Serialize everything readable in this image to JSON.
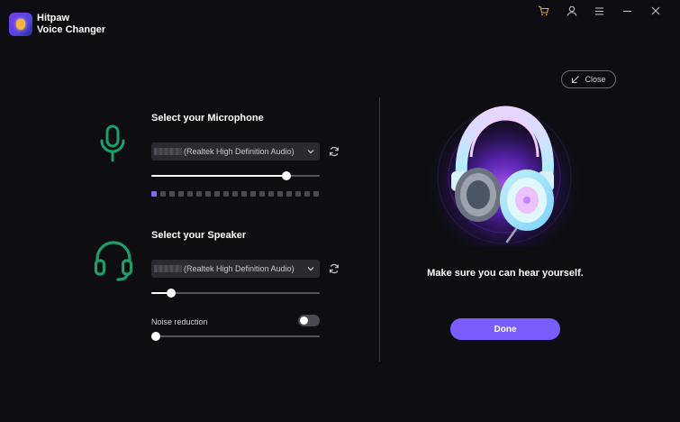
{
  "app": {
    "name_line1": "Hitpaw",
    "name_line2": "Voice Changer"
  },
  "window_controls": [
    "cart-icon",
    "user-icon",
    "menu-icon",
    "minimize-icon",
    "close-window-icon"
  ],
  "close_button": {
    "label": "Close",
    "icon": "arrow-down-left-icon"
  },
  "microphone": {
    "title": "Select your Microphone",
    "device": "(Realtek High Definition Audio)",
    "volume": 0.8,
    "level_segments_total": 19,
    "level_segments_active": 1
  },
  "speaker": {
    "title": "Select your Speaker",
    "device": "(Realtek High Definition Audio)",
    "volume": 0.12
  },
  "noise_reduction": {
    "label": "Noise reduction",
    "enabled": false,
    "level": 0.0
  },
  "right_panel": {
    "message": "Make sure you can hear yourself.",
    "done_label": "Done"
  },
  "colors": {
    "background": "#0e0e12",
    "accent": "#7a5cff",
    "device_icon_green": "#1f9d6b",
    "meter_active": "#7d6bff"
  }
}
